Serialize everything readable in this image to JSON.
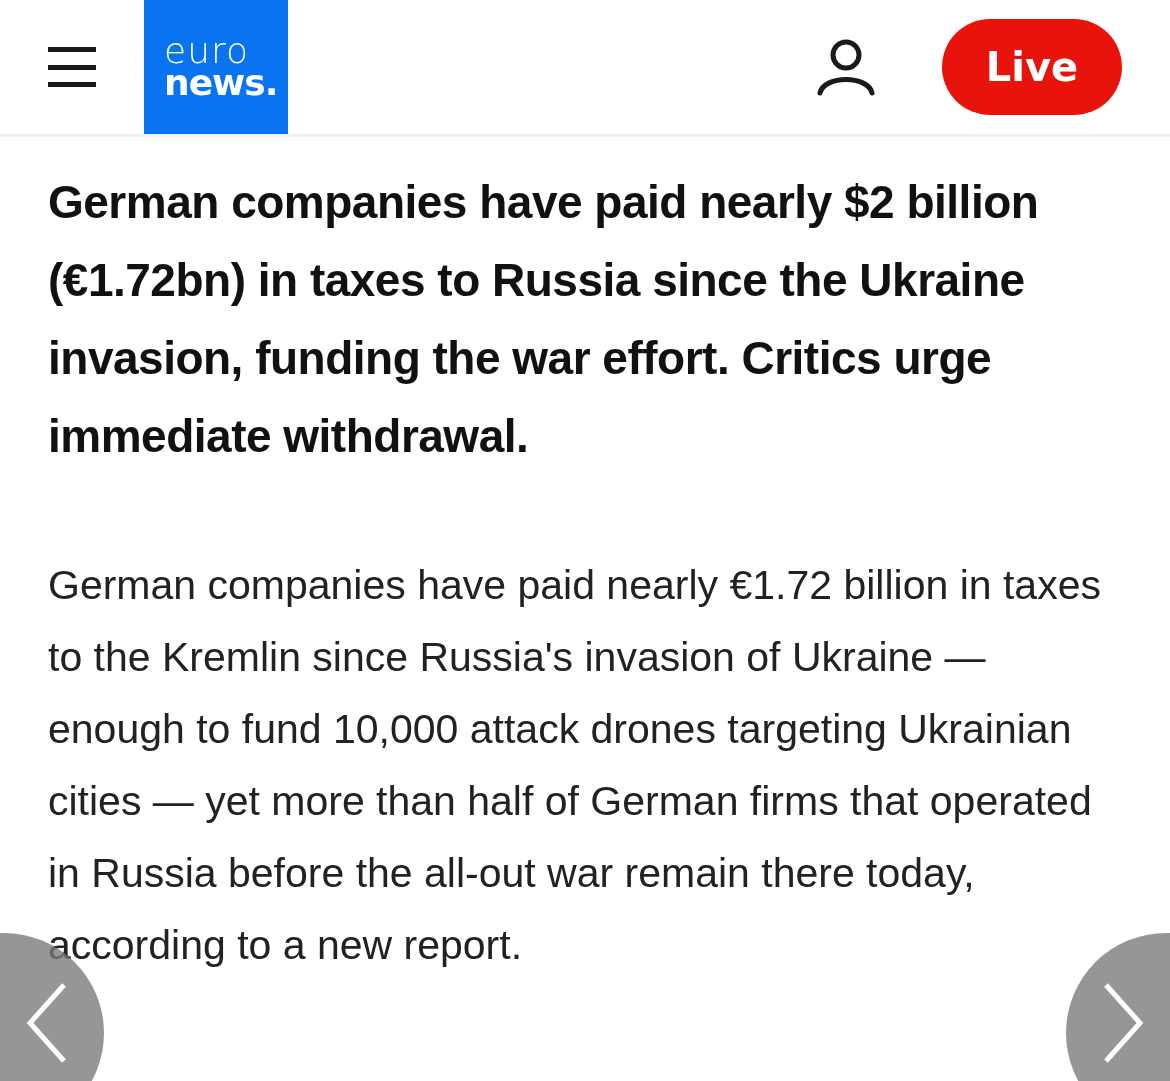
{
  "header": {
    "logo": {
      "line_1": "euro",
      "line_2": "news."
    },
    "live_button": "Live"
  },
  "article": {
    "headline": "German companies have paid nearly $2 billion (€1.72bn) in taxes to Russia since the Ukraine invasion, funding the war effort. Critics urge immediate withdrawal.",
    "body": "German companies have paid nearly €1.72 billion in taxes to the Kremlin since Russia's invasion of Ukraine — enough to fund 10,000 attack drones targeting Ukrainian cities — yet more than half of German firms that operated in Russia before the all-out war remain there today, according to a new report."
  }
}
